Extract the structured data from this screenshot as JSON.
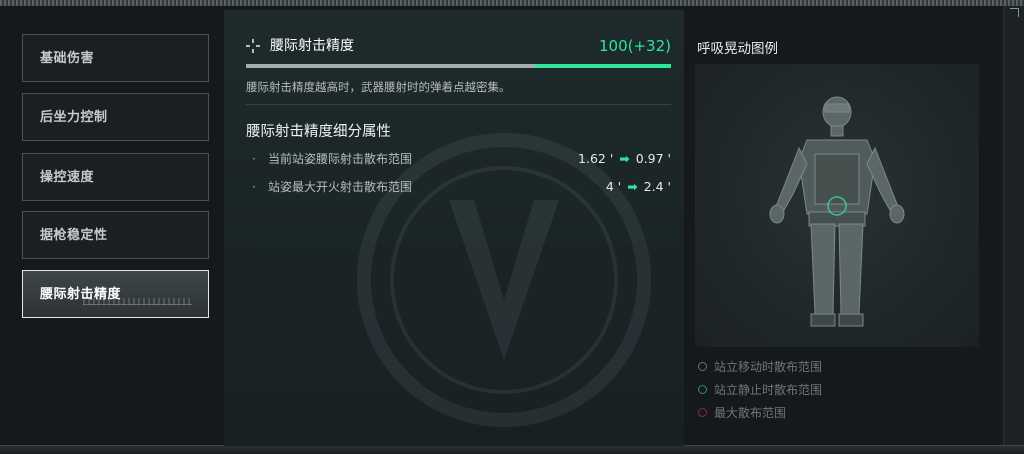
{
  "sidebar": {
    "items": [
      {
        "label": "基础伤害",
        "active": false
      },
      {
        "label": "后坐力控制",
        "active": false
      },
      {
        "label": "操控速度",
        "active": false
      },
      {
        "label": "据枪稳定性",
        "active": false
      },
      {
        "label": "腰际射击精度",
        "active": true
      }
    ]
  },
  "stat": {
    "icon": "crosshair-icon",
    "title": "腰际射击精度",
    "value_text": "100(+32)",
    "base_fraction": 0.68,
    "bonus_fraction": 0.32,
    "description": "腰际射击精度越高时，武器腰射时的弹着点越密集。"
  },
  "attributes": {
    "title": "腰际射击精度细分属性",
    "rows": [
      {
        "name": "当前站姿腰际射击散布范围",
        "from": "1.62 '",
        "to": "0.97 '"
      },
      {
        "name": "站姿最大开火射击散布范围",
        "from": "4 '",
        "to": "2.4 '"
      }
    ]
  },
  "preview": {
    "title": "呼吸晃动图例",
    "legend": [
      {
        "label": "站立移动时散布范围",
        "color": "#6b7375"
      },
      {
        "label": "站立静止时散布范围",
        "color": "#2f8f66"
      },
      {
        "label": "最大散布范围",
        "color": "#8a2f34"
      }
    ]
  },
  "colors": {
    "accent": "#2ee59a",
    "panel": "#1e2a2c",
    "background": "#15191c"
  }
}
